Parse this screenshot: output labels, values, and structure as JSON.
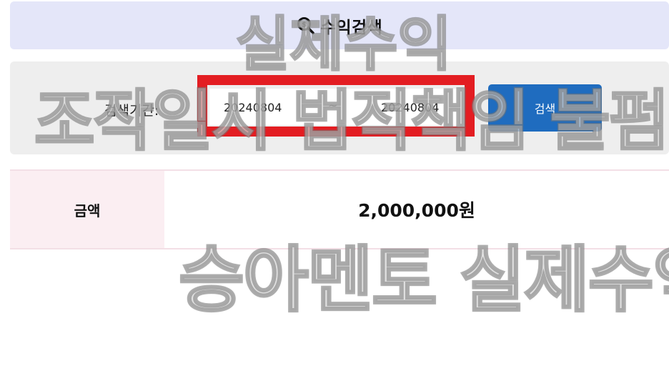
{
  "header": {
    "title": "수익검색",
    "icon": "money-search-icon"
  },
  "search": {
    "period_label": "검색기간:",
    "date_from": "20240804",
    "date_separator": "~",
    "date_to": "20240804",
    "button_label": "검색"
  },
  "result": {
    "amount_label": "금액",
    "amount_value": "2,000,000원"
  },
  "watermarks": {
    "line1": "실제수익",
    "line2": "조작일시 법적책임 불펌금지",
    "line3": "승아멘토 실제수익"
  },
  "colors": {
    "header_bg": "#e4e6f9",
    "panel_bg": "#eeeeee",
    "highlight": "#e31d22",
    "button_bg": "#1f6cbf",
    "label_cell_bg": "#fbeef2"
  }
}
